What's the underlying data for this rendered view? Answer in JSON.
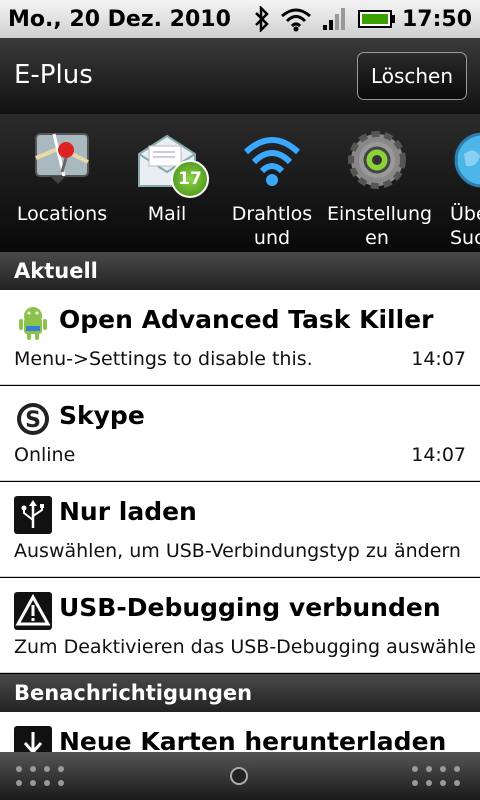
{
  "status_bar": {
    "date": "Mo., 20 Dez. 2010",
    "time": "17:50",
    "icons": [
      "bluetooth-icon",
      "wifi-icon",
      "signal-icon",
      "battery-icon"
    ]
  },
  "header": {
    "carrier": "E-Plus",
    "clear_label": "Löschen"
  },
  "quick_settings": [
    {
      "label": "Locations",
      "icon": "map-pin-icon"
    },
    {
      "label": "Mail",
      "icon": "mail-icon",
      "badge": "17"
    },
    {
      "label": "Drahtlos\nund",
      "icon": "wifi-icon"
    },
    {
      "label": "Einstellung\nen",
      "icon": "gear-icon"
    },
    {
      "label": "Übe\nSuc",
      "icon": "globe-icon"
    }
  ],
  "sections": {
    "current": "Aktuell",
    "notifications": "Benachrichtigungen"
  },
  "current_items": [
    {
      "title": "Open Advanced Task Killer",
      "subtitle": "Menu->Settings to disable this.",
      "time": "14:07",
      "icon": "android-icon"
    },
    {
      "title": "Skype",
      "subtitle": "Online",
      "time": "14:07",
      "icon": "skype-icon"
    },
    {
      "title": "Nur laden",
      "subtitle": "Auswählen, um USB-Verbindungstyp zu ändern",
      "time": "",
      "icon": "usb-icon"
    },
    {
      "title": "USB-Debugging verbunden",
      "subtitle": "Zum Deaktivieren das USB-Debugging auswähle",
      "time": "",
      "icon": "warning-icon"
    }
  ],
  "notification_items": [
    {
      "title": "Neue Karten herunterladen",
      "icon": "download-icon"
    }
  ]
}
